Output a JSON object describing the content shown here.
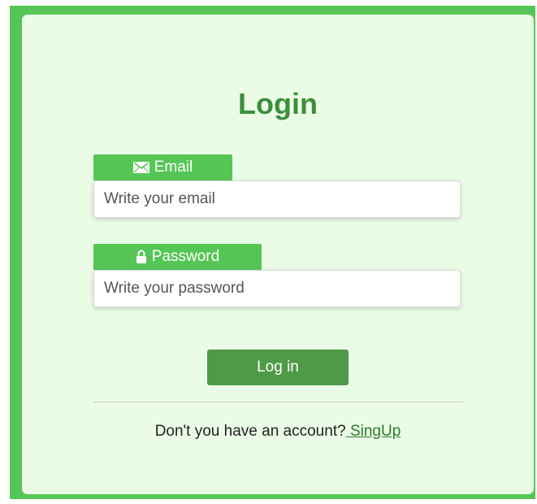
{
  "title": "Login",
  "email": {
    "label": "Email",
    "icon": "envelope-icon",
    "placeholder": "Write your email",
    "value": ""
  },
  "password": {
    "label": "Password",
    "icon": "lock-icon",
    "placeholder": "Write your password",
    "value": ""
  },
  "login_button": "Log in",
  "footer": {
    "text": "Don't you have an account?",
    "link_text": " SingUp"
  },
  "colors": {
    "frame": "#55c655",
    "card": "#ebfce6",
    "title": "#3c8f3c",
    "label_tab": "#55c655",
    "button": "#4f9a48",
    "link": "#2a7a2a"
  }
}
